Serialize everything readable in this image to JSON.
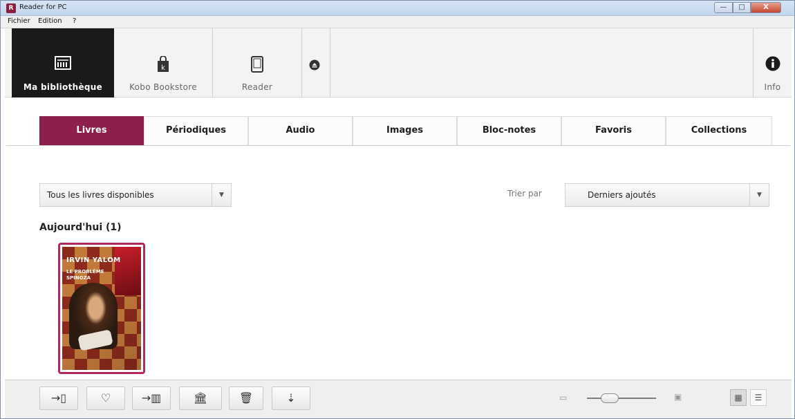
{
  "window": {
    "title": "Reader for PC",
    "app_icon_glyph": "R",
    "controls": {
      "minimize": "—",
      "maximize": "□",
      "close": "X"
    }
  },
  "menu": {
    "items": [
      "Fichier",
      "Edition",
      "?"
    ]
  },
  "toolbar": {
    "nav": [
      {
        "label": "Ma bibliothèque",
        "icon": "library-icon",
        "active": true
      },
      {
        "label": "Kobo Bookstore",
        "icon": "shopping-bag-icon",
        "active": false
      },
      {
        "label": "Reader",
        "icon": "ereader-device-icon",
        "active": false
      }
    ],
    "eject_icon": "eject-icon",
    "info": {
      "label": "Info",
      "icon": "info-icon"
    }
  },
  "tabs": [
    {
      "label": "Livres",
      "active": true
    },
    {
      "label": "Périodiques"
    },
    {
      "label": "Audio"
    },
    {
      "label": "Images"
    },
    {
      "label": "Bloc-notes"
    },
    {
      "label": "Favoris"
    },
    {
      "label": "Collections"
    }
  ],
  "filters": {
    "scope_value": "Tous les livres disponibles",
    "sort_label": "Trier par",
    "sort_value": "Derniers ajoutés"
  },
  "library": {
    "section_title": "Aujourd'hui (1)",
    "books": [
      {
        "author": "IRVIN YALOM",
        "title": "LE PROBLÈME SPINOZA"
      }
    ]
  },
  "bottom_bar": {
    "actions": [
      {
        "name": "send-to-reader-button",
        "glyph": "→▯",
        "icon": "send-to-device-icon"
      },
      {
        "name": "favorite-button",
        "glyph": "♡",
        "icon": "heart-icon"
      },
      {
        "name": "add-to-collection-button",
        "glyph": "→▥",
        "icon": "add-to-collection-icon"
      },
      {
        "name": "library-transfer-button",
        "glyph": "🏛",
        "icon": "library-transfer-icon"
      },
      {
        "name": "delete-button",
        "glyph": "🗑",
        "icon": "trash-icon"
      },
      {
        "name": "export-button",
        "glyph": "⇣",
        "icon": "download-icon"
      }
    ],
    "zoom": {
      "level": 0.2
    },
    "view_modes": [
      {
        "name": "grid-view",
        "glyph": "▦",
        "icon": "grid-view-icon",
        "active": true
      },
      {
        "name": "list-view",
        "glyph": "☰",
        "icon": "list-view-icon",
        "active": false
      }
    ]
  },
  "colors": {
    "accent": "#8e1e4b",
    "book_border": "#b0285c",
    "active_nav": "#1a1a1a"
  }
}
